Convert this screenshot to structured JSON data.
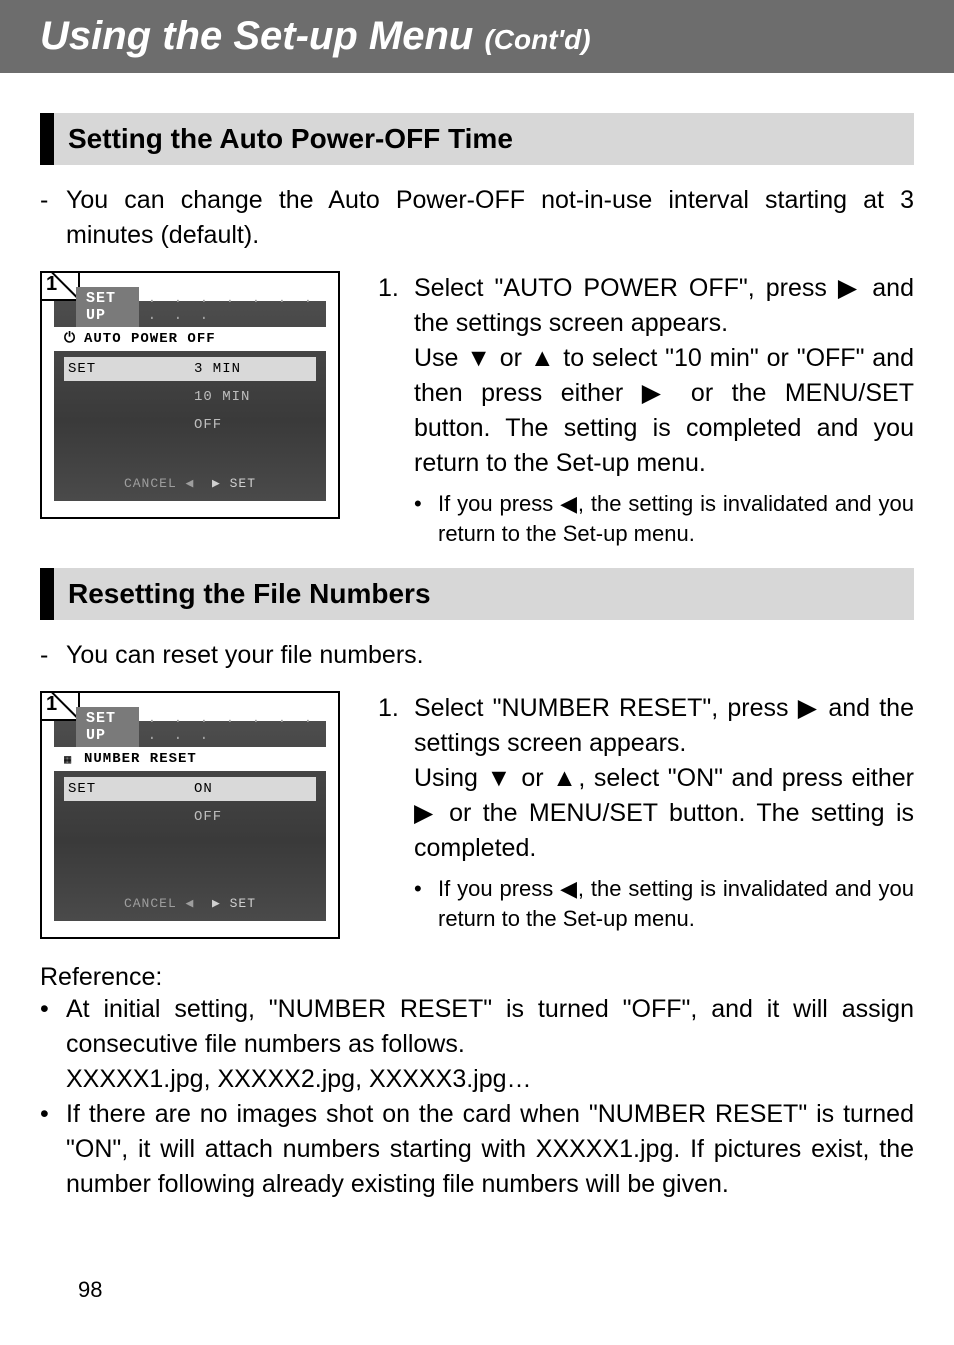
{
  "header": {
    "main": "Using the Set-up Menu ",
    "sub": "(Cont'd)"
  },
  "section1": {
    "title": "Setting the Auto Power-OFF Time",
    "intro": "You can change the Auto Power-OFF not-in-use interval starting at 3 minutes (default).",
    "step_num": "1.",
    "step_body": "Select \"AUTO POWER OFF\", press ▶ and the settings screen appears.\nUse ▼ or ▲ to select \"10 min\" or \"OFF\" and then press either ▶ or the MENU/SET button. The setting is completed and you return to the Set-up menu.",
    "bullet": "If you press ◀, the setting is invalidated and you return to the Set-up menu.",
    "lcd": {
      "step": "1",
      "tab": "SET UP",
      "strip_label": "AUTO POWER OFF",
      "rows": [
        {
          "left": "SET",
          "right": "3 MIN",
          "sel": true
        },
        {
          "left": "",
          "right": "10 MIN",
          "sel": false
        },
        {
          "left": "",
          "right": "OFF",
          "sel": false
        }
      ],
      "footer_cancel": "CANCEL ◀",
      "footer_set": "▶ SET"
    }
  },
  "section2": {
    "title": "Resetting the File Numbers",
    "intro": "You can reset your file numbers.",
    "step_num": "1.",
    "step_body": "Select \"NUMBER RESET\", press ▶ and the settings screen appears.\nUsing ▼ or ▲, select \"ON\" and press either ▶ or the MENU/SET button. The setting is completed.",
    "bullet": "If you press ◀, the setting is invalidated and you return to the Set-up menu.",
    "lcd": {
      "step": "1",
      "tab": "SET UP",
      "strip_label": "NUMBER RESET",
      "rows": [
        {
          "left": "SET",
          "right": "ON",
          "sel": true
        },
        {
          "left": "",
          "right": "OFF",
          "sel": false
        }
      ],
      "footer_cancel": "CANCEL ◀",
      "footer_set": "▶ SET"
    }
  },
  "reference": {
    "head": "Reference:",
    "items": [
      "At initial setting, \"NUMBER RESET\" is turned \"OFF\", and it will assign consecutive file numbers as follows.",
      "If there are no images shot on the card when \"NUMBER RESET\" is turned \"ON\", it will attach numbers starting with XXXXX1.jpg. If pictures exist, the number following already existing file numbers will be given."
    ],
    "sub1": "XXXXX1.jpg,   XXXXX2.jpg,   XXXXX3.jpg…"
  },
  "page": "98"
}
